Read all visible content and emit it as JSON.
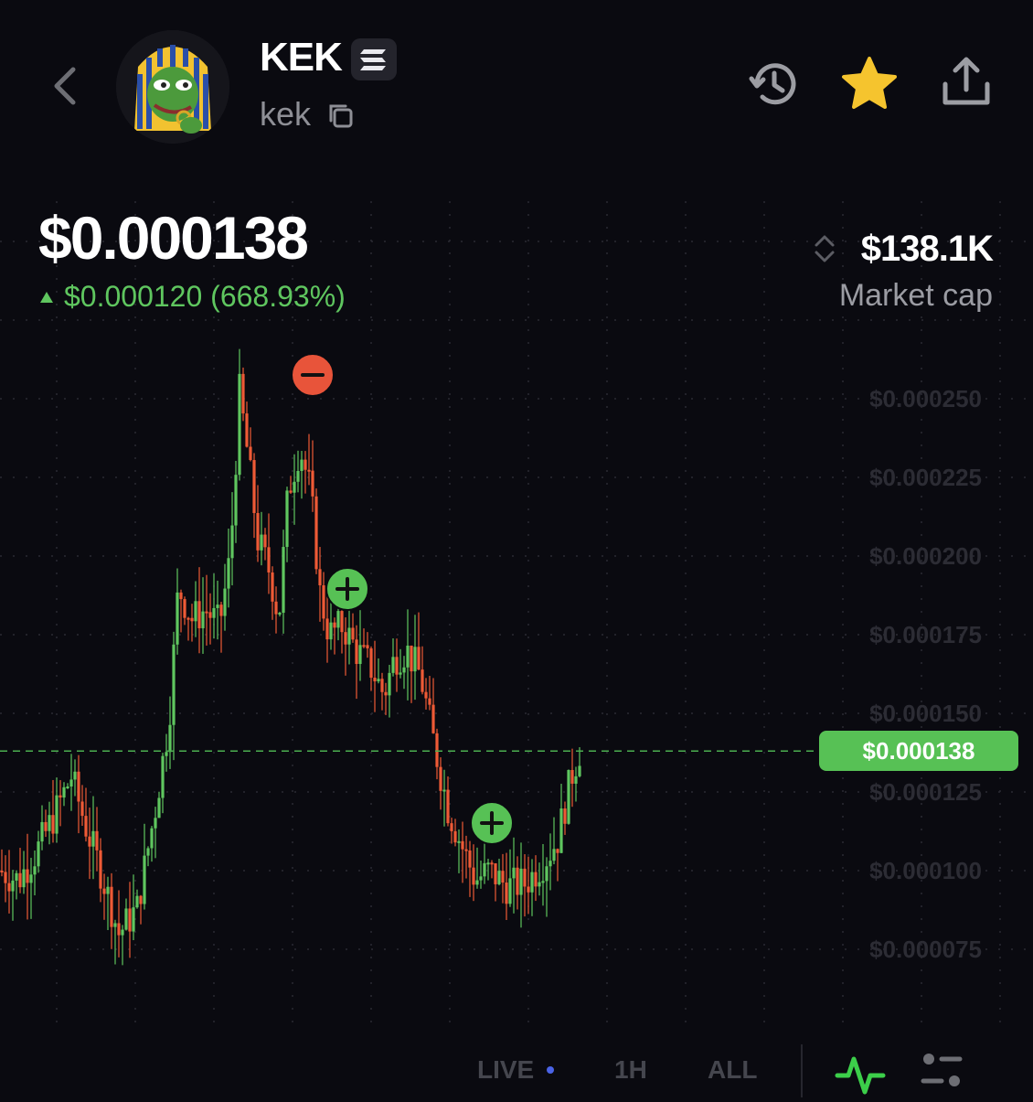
{
  "header": {
    "ticker": "KEK",
    "name": "kek",
    "back_icon": "chevron-left-icon",
    "chain_icon": "solana-icon",
    "copy_icon": "copy-icon",
    "history_icon": "history-icon",
    "favorite_icon": "star-icon",
    "favorited": true,
    "share_icon": "share-icon"
  },
  "price": {
    "current": "$0.000138",
    "change": "$0.000120 (668.93%)",
    "direction": "up"
  },
  "market_cap": {
    "value": "$138.1K",
    "label": "Market cap"
  },
  "chart_data": {
    "type": "candlestick",
    "y_axis_labels": [
      "$0.000250",
      "$0.000225",
      "$0.000200",
      "$0.000175",
      "$0.000150",
      "$0.000125",
      "$0.000100",
      "$0.000075"
    ],
    "y_ticks": [
      0.00025,
      0.000225,
      0.0002,
      0.000175,
      0.00015,
      0.000125,
      0.0001,
      7.5e-05
    ],
    "current_price": 0.000138,
    "current_price_label": "$0.000138",
    "markers": [
      {
        "type": "sell",
        "icon": "minus-icon",
        "color": "#e8543a"
      },
      {
        "type": "buy",
        "icon": "plus-icon",
        "color": "#57c155"
      },
      {
        "type": "buy",
        "icon": "plus-icon",
        "color": "#57c155"
      }
    ],
    "colors": {
      "up": "#5fc65f",
      "down": "#ee5a36",
      "grid": "#2a2a33",
      "price_line": "#4caf50"
    }
  },
  "timeframes": {
    "live": "LIVE",
    "h1": "1H",
    "all": "ALL"
  },
  "toolbar": {
    "chart_icon": "line-chart-icon",
    "settings_icon": "chart-settings-icon"
  }
}
